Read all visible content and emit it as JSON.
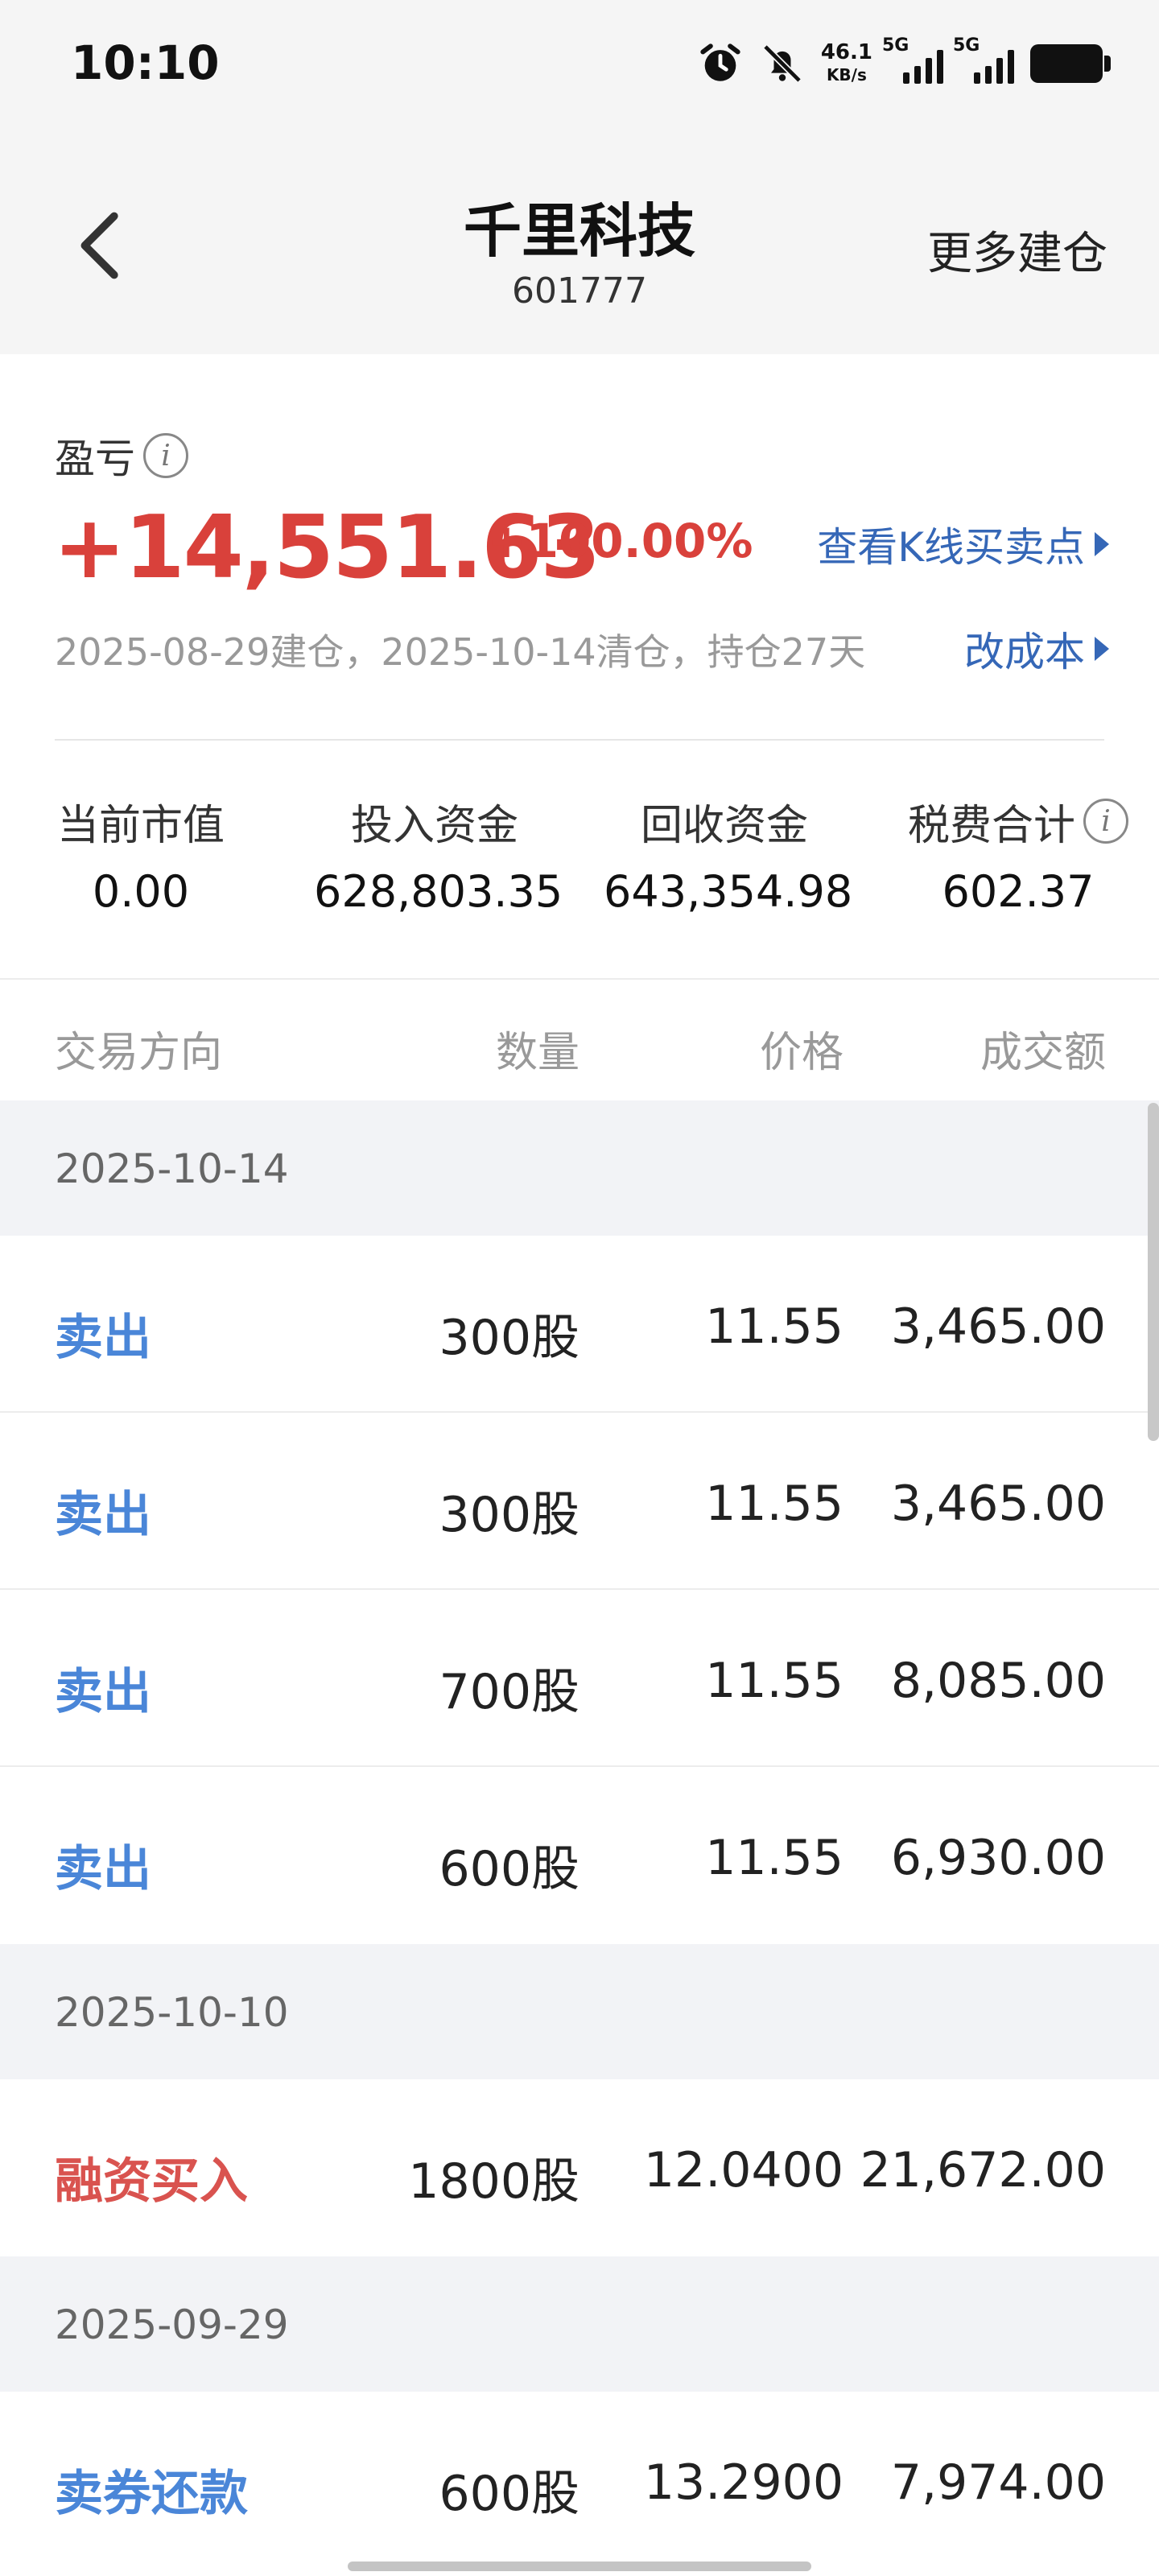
{
  "status": {
    "time": "10:10",
    "netspeed_value": "46.1",
    "netspeed_unit": "KB/s",
    "sim1": "5G",
    "sim2": "5G"
  },
  "header": {
    "title": "千里科技",
    "code": "601777",
    "more": "更多建仓"
  },
  "summary": {
    "pl_label": "盈亏",
    "pl_value": "+14,551.63",
    "pl_pct": "+100.00%",
    "kline_link": "查看K线买卖点",
    "hold_info": "2025-08-29建仓，2025-10-14清仓，持仓27天",
    "cost_link": "改成本",
    "stats": [
      {
        "label": "当前市值",
        "value": "0.00"
      },
      {
        "label": "投入资金",
        "value": "628,803.35"
      },
      {
        "label": "回收资金",
        "value": "643,354.98"
      },
      {
        "label": "税费合计",
        "value": "602.37"
      }
    ]
  },
  "table": {
    "headers": {
      "direction": "交易方向",
      "qty": "数量",
      "price": "价格",
      "amount": "成交额"
    },
    "groups": [
      {
        "date": "2025-10-14",
        "rows": [
          {
            "dir": "卖出",
            "qty": "300股",
            "price": "11.55",
            "amount": "3,465.00"
          },
          {
            "dir": "卖出",
            "qty": "300股",
            "price": "11.55",
            "amount": "3,465.00"
          },
          {
            "dir": "卖出",
            "qty": "700股",
            "price": "11.55",
            "amount": "8,085.00"
          },
          {
            "dir": "卖出",
            "qty": "600股",
            "price": "11.55",
            "amount": "6,930.00"
          }
        ]
      },
      {
        "date": "2025-10-10",
        "rows": [
          {
            "dir": "融资买入",
            "qty": "1800股",
            "price": "12.0400",
            "amount": "21,672.00"
          }
        ]
      },
      {
        "date": "2025-09-29",
        "rows": [
          {
            "dir": "卖券还款",
            "qty": "600股",
            "price": "13.2900",
            "amount": "7,974.00"
          }
        ]
      }
    ]
  },
  "colors": {
    "sell": "#4a86d8",
    "buy": "#d9534f",
    "profit": "#d9413b",
    "link": "#3567b7"
  }
}
